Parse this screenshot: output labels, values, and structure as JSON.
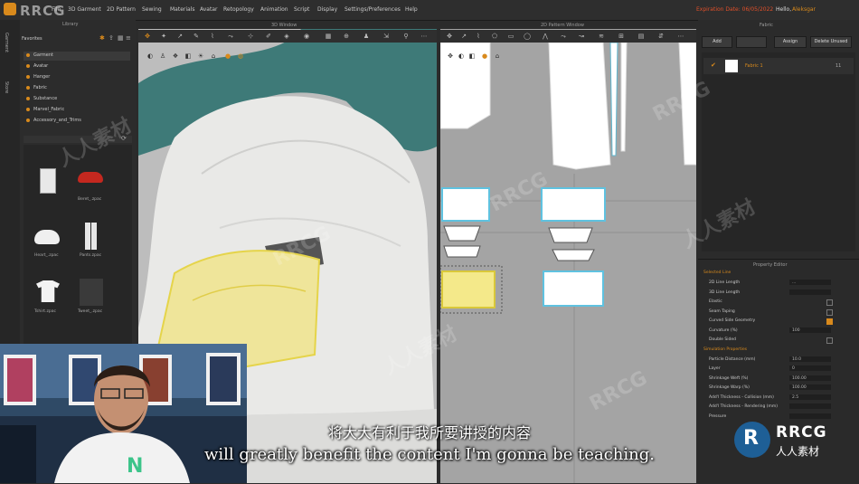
{
  "app": {
    "brand": "RRCG",
    "menu": [
      "File",
      "3D Garment",
      "2D Pattern",
      "Sewing",
      "Materials",
      "Avatar",
      "Retopology",
      "Animation",
      "Script",
      "Display",
      "Settings/Preferences",
      "Help"
    ],
    "expiry": "Expiration Date: 06/05/2022",
    "hello": "Hello,",
    "user": "Aleksgar"
  },
  "side_tabs": [
    "Garment",
    "Store"
  ],
  "library": {
    "title": "Library",
    "favorites_label": "Favorites",
    "favorites": [
      "Garment",
      "Avatar",
      "Hanger",
      "Fabric",
      "Substance",
      "Marvel_Fabric",
      "Accessory_and_Trims"
    ],
    "thumbnails": [
      {
        "label": ""
      },
      {
        "label": "Beret_.zpac"
      },
      {
        "label": "Heart_.zpac"
      },
      {
        "label": "Pants.zpac"
      },
      {
        "label": "Tshirt.zpac"
      },
      {
        "label": "Tweet_.zpac"
      }
    ]
  },
  "view3d": {
    "title": "3D Window"
  },
  "pattern": {
    "title": "2D Pattern Window"
  },
  "fabric": {
    "title": "Fabric",
    "buttons": [
      "Add",
      "",
      "Assign",
      "Delete Unused"
    ],
    "items": [
      {
        "name": "Fabric 1",
        "count": "11"
      }
    ]
  },
  "property_editor": {
    "title": "Property Editor",
    "rows": [
      {
        "type": "section",
        "label": "Selected Line"
      },
      {
        "type": "field",
        "label": "2D Line Length",
        "value": "..."
      },
      {
        "type": "field",
        "label": "3D Line Length",
        "value": ""
      },
      {
        "type": "check",
        "label": "Elastic",
        "checked": false
      },
      {
        "type": "check",
        "label": "Seam Taping",
        "checked": false
      },
      {
        "type": "check",
        "label": "Curved Side Geometry",
        "checked": true
      },
      {
        "type": "field",
        "label": "Curvature (%)",
        "value": "100"
      },
      {
        "type": "check",
        "label": "Double Sided",
        "checked": false
      },
      {
        "type": "section",
        "label": "Simulation Properties"
      },
      {
        "type": "field",
        "label": "Particle Distance (mm)",
        "value": "10.0"
      },
      {
        "type": "field",
        "label": "Layer",
        "value": "0"
      },
      {
        "type": "field",
        "label": "Shrinkage Weft (%)",
        "value": "100.00"
      },
      {
        "type": "field",
        "label": "Shrinkage Warp (%)",
        "value": "100.00"
      },
      {
        "type": "field",
        "label": "Add'l Thickness - Collision (mm)",
        "value": "2.5"
      },
      {
        "type": "field",
        "label": "Add'l Thickness - Rendering (mm)",
        "value": ""
      },
      {
        "type": "field",
        "label": "Pressure",
        "value": ""
      }
    ]
  },
  "subtitles": {
    "cn": "将大大有利于我所要讲授的内容",
    "en": "will greatly benefit the content I'm gonna be teaching."
  },
  "watermark": {
    "text": "RRCG",
    "cn": "人人素材"
  },
  "badge": {
    "text": "RRCG",
    "cn": "人人素材"
  }
}
